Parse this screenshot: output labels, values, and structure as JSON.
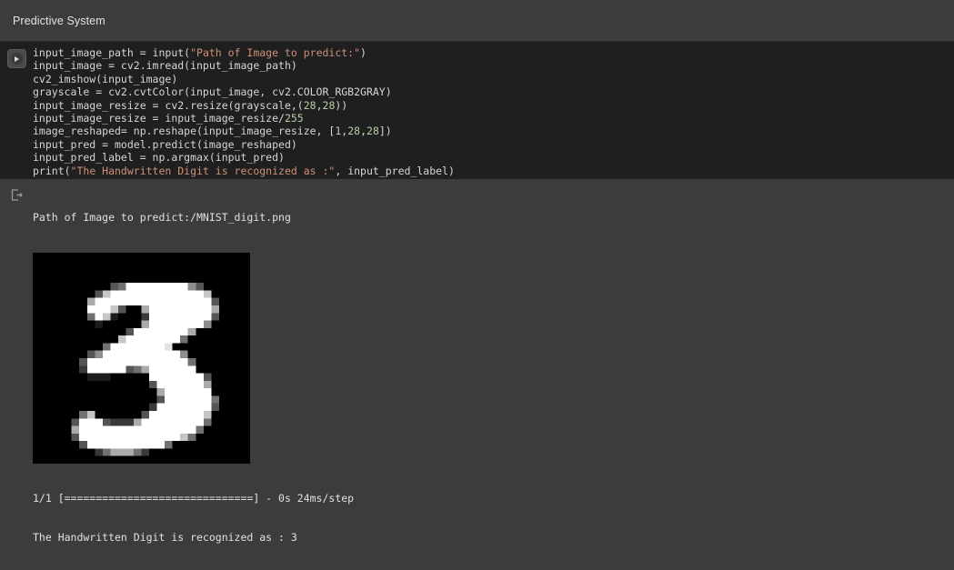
{
  "header": {
    "title": "Predictive System"
  },
  "cell": {
    "run_icon": "run-play-icon",
    "output_icon": "output-arrow-icon",
    "code_lines": [
      [
        {
          "t": "plain",
          "v": "input_image_path = input("
        },
        {
          "t": "str",
          "v": "\"Path of Image to predict:\""
        },
        {
          "t": "plain",
          "v": ")"
        }
      ],
      [
        {
          "t": "plain",
          "v": "input_image = cv2.imread(input_image_path)"
        }
      ],
      [
        {
          "t": "plain",
          "v": "cv2_imshow(input_image)"
        }
      ],
      [
        {
          "t": "plain",
          "v": "grayscale = cv2.cvtColor(input_image, cv2.COLOR_RGB2GRAY)"
        }
      ],
      [
        {
          "t": "plain",
          "v": "input_image_resize = cv2.resize(grayscale,("
        },
        {
          "t": "num",
          "v": "28"
        },
        {
          "t": "plain",
          "v": ","
        },
        {
          "t": "num",
          "v": "28"
        },
        {
          "t": "plain",
          "v": "))"
        }
      ],
      [
        {
          "t": "plain",
          "v": "input_image_resize = input_image_resize/"
        },
        {
          "t": "num",
          "v": "255"
        }
      ],
      [
        {
          "t": "plain",
          "v": "image_reshaped= np.reshape(input_image_resize, ["
        },
        {
          "t": "num",
          "v": "1"
        },
        {
          "t": "plain",
          "v": ","
        },
        {
          "t": "num",
          "v": "28"
        },
        {
          "t": "plain",
          "v": ","
        },
        {
          "t": "num",
          "v": "28"
        },
        {
          "t": "plain",
          "v": "])"
        }
      ],
      [
        {
          "t": "plain",
          "v": "input_pred = model.predict(image_reshaped)"
        }
      ],
      [
        {
          "t": "plain",
          "v": "input_pred_label = np.argmax(input_pred)"
        }
      ],
      [
        {
          "t": "plain",
          "v": "print("
        },
        {
          "t": "str",
          "v": "\"The Handwritten Digit is recognized as :\""
        },
        {
          "t": "plain",
          "v": ", input_pred_label)"
        }
      ]
    ]
  },
  "output": {
    "prompt_line": "Path of Image to predict:/MNIST_digit.png",
    "image_alt": "handwritten-digit-3",
    "progress_line": "1/1 [==============================] - 0s 24ms/step",
    "result_line": "The Handwritten Digit is recognized as : 3"
  },
  "colors": {
    "header_bg": "#3c3c3c",
    "code_bg": "#1f1f1f",
    "output_bg": "#3c3c3c",
    "string": "#ce9178",
    "number": "#b5cea8",
    "text": "#d6d6d6"
  }
}
